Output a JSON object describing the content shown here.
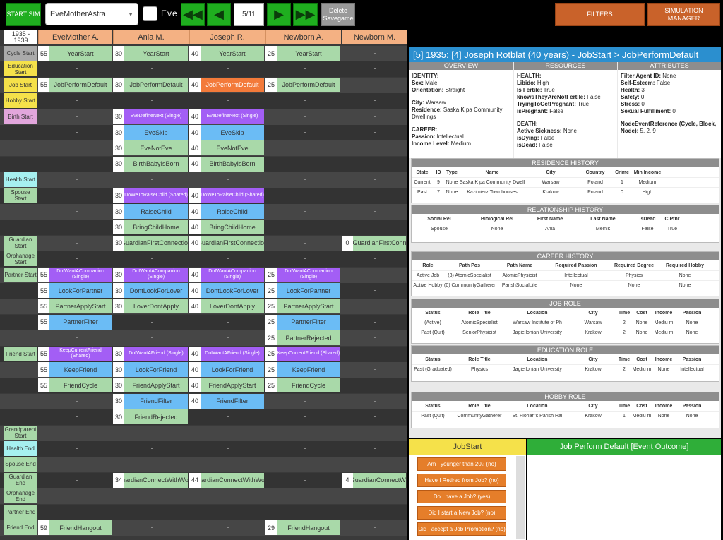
{
  "toolbar": {
    "start_label": "START SIM",
    "agent_dropdown": "EveMotherAstra",
    "checkbox_label": "Eve",
    "page": "5/11",
    "delete_label": "Delete Savegame",
    "filters_label": "FILTERS",
    "simmanager_label": "SIMULATION MANAGER"
  },
  "grid": {
    "year_header": "1935 - 1939",
    "characters": [
      "EveMother A.",
      "Ania M.",
      "Joseph R.",
      "Newborn A.",
      "Newborn M."
    ],
    "row_labels": [
      "Cycle Start",
      "Education Start",
      "Job Start",
      "Hobby Start",
      "Birth Start",
      "",
      "",
      "",
      "Health Start",
      "Spouse Start",
      "",
      "",
      "Guardian Start",
      "Orphanage Start",
      "Partner Start",
      "",
      "",
      "",
      "",
      "Friend Start",
      "",
      "",
      "",
      "",
      "Grandparent Start",
      "Health End",
      "Spouse End",
      "Guardian End",
      "Orphanage End",
      "Partner End",
      "Friend End"
    ],
    "cells": {
      "r0": [
        [
          "55",
          "YearStart"
        ],
        [
          "30",
          "YearStart"
        ],
        [
          "40",
          "YearStart"
        ],
        [
          "25",
          "YearStart"
        ]
      ],
      "r2": [
        [
          "55",
          "JobPerformDefault"
        ],
        [
          "30",
          "JobPerformDefault"
        ],
        [
          "40",
          "JobPerformDefault"
        ],
        [
          "25",
          "JobPerformDefault"
        ]
      ],
      "r4": [
        [
          "30",
          "EveDefineNext (Single)"
        ],
        [
          "40",
          "EveDefineNext (Single)"
        ]
      ],
      "r5": [
        [
          "30",
          "EveSkip"
        ],
        [
          "40",
          "EveSkip"
        ]
      ],
      "r6": [
        [
          "30",
          "EveNotEve"
        ],
        [
          "40",
          "EveNotEve"
        ]
      ],
      "r7": [
        [
          "30",
          "BirthBabyIsBorn"
        ],
        [
          "40",
          "BirthBabyIsBorn"
        ]
      ],
      "r9": [
        [
          "30",
          "DoWeToRaiseChild (Shared)"
        ],
        [
          "40",
          "DoWeToRaiseChild (Shared)"
        ]
      ],
      "r10": [
        [
          "30",
          "RaiseChild"
        ],
        [
          "40",
          "RaiseChild"
        ]
      ],
      "r11": [
        [
          "30",
          "BringChildHome"
        ],
        [
          "40",
          "BringChildHome"
        ]
      ],
      "r12": [
        [
          "30",
          "GuardianFirstConnection"
        ],
        [
          "40",
          "GuardianFirstConnection"
        ],
        [
          "0",
          "GuardianFirstConn"
        ]
      ],
      "r14": [
        [
          "55",
          "DoIWantACompanion (Single)"
        ],
        [
          "30",
          "DoIWantACompanion (Single)"
        ],
        [
          "40",
          "DoIWantACompanion (Single)"
        ],
        [
          "25",
          "DoIWantACompanion (Single)"
        ]
      ],
      "r15": [
        [
          "55",
          "LookForPartner"
        ],
        [
          "30",
          "DontLookForLover"
        ],
        [
          "40",
          "DontLookForLover"
        ],
        [
          "25",
          "LookForPartner"
        ]
      ],
      "r16": [
        [
          "55",
          "PartnerApplyStart"
        ],
        [
          "30",
          "LoverDontApply"
        ],
        [
          "40",
          "LoverDontApply"
        ],
        [
          "25",
          "PartnerApplyStart"
        ]
      ],
      "r17": [
        [
          "55",
          "PartnerFilter"
        ],
        [
          "25",
          "PartnerFilter"
        ]
      ],
      "r18": [
        [
          "25",
          "PartnerRejected"
        ]
      ],
      "r19": [
        [
          "55",
          "KeepCurrentFriend (Shared)"
        ],
        [
          "30",
          "DoIWantAFriend (Single)"
        ],
        [
          "40",
          "DoIWantAFriend (Single)"
        ],
        [
          "25",
          "KeepCurrentFriend (Shared)"
        ]
      ],
      "r20": [
        [
          "55",
          "KeepFriend"
        ],
        [
          "30",
          "LookForFriend"
        ],
        [
          "40",
          "LookForFriend"
        ],
        [
          "25",
          "KeepFriend"
        ]
      ],
      "r21": [
        [
          "55",
          "FriendCycle"
        ],
        [
          "30",
          "FriendApplyStart"
        ],
        [
          "40",
          "FriendApplyStart"
        ],
        [
          "25",
          "FriendCycle"
        ]
      ],
      "r22": [
        [
          "30",
          "FriendFilter"
        ],
        [
          "40",
          "FriendFilter"
        ]
      ],
      "r23": [
        [
          "30",
          "FriendRejected"
        ]
      ],
      "r27": [
        [
          "34",
          "GuardianConnectWithWorld"
        ],
        [
          "44",
          "GuardianConnectWithWorld"
        ],
        [
          "4",
          "GuardianConnectWit"
        ]
      ],
      "r30": [
        [
          "59",
          "FriendHangout"
        ],
        [
          "29",
          "FriendHangout"
        ]
      ]
    }
  },
  "panel": {
    "title": "[5] 1935: [4] Joseph Rotblat (40 years) -  JobStart > JobPerformDefault",
    "overview_hdr": "OVERVIEW",
    "resources_hdr": "RESOURCES",
    "attributes_hdr": "ATTRIBUTES",
    "overview": {
      "identity": "IDENTITY:",
      "sex": "Sex:",
      "sex_v": " Male",
      "orient": "Orientation:",
      "orient_v": " Straight",
      "city": "City:",
      "city_v": " Warsaw",
      "res": "Residence:",
      "res_v": " Saska K pa Community Dwellings",
      "career": "CAREER:",
      "passion": "Passion:",
      "passion_v": " Intellectual",
      "income": "Income Level:",
      "income_v": " Medium"
    },
    "resources": {
      "health": "HEALTH:",
      "libido": "Libido:",
      "libido_v": " High",
      "fertile": "Is Fertile:",
      "fertile_v": " True",
      "knows": "knowsTheyAreNotFertile:",
      "knows_v": " False",
      "trying": "TryingToGetPregnant:",
      "trying_v": " True",
      "preg": "isPregnant:",
      "preg_v": " False",
      "death": "DEATH:",
      "sick": "Active Sickness:",
      "sick_v": " None",
      "dying": "isDying:",
      "dying_v": " False",
      "dead": "isDead:",
      "dead_v": " False"
    },
    "attributes": {
      "fid": "Filter Agent ID:",
      "fid_v": " None",
      "self": "Self-Esteem:",
      "self_v": " False",
      "health": "Health:",
      "health_v": " 3",
      "safety": "Safety:",
      "safety_v": " 0",
      "stress": "Stress:",
      "stress_v": " 0",
      "sex": "Sexual Fulfillment:",
      "sex_v": " 0",
      "node": "NodeEventReference (Cycle, Block, Node):",
      "node_v": " 5, 2, 9"
    },
    "residence": {
      "title": "RESIDENCE HISTORY",
      "headers": [
        "State",
        "ID",
        "Type",
        "Name",
        "City",
        "Country",
        "Crime",
        "Min Income"
      ],
      "rows": [
        [
          "Current",
          "9",
          "None",
          "Saska K pa Community Dwellings",
          "Warsaw",
          "Poland",
          "1",
          "Medium"
        ],
        [
          "Past",
          "7",
          "None",
          "Kazimierz Townhouses",
          "Krakow",
          "Poland",
          "0",
          "High"
        ]
      ]
    },
    "relationship": {
      "title": "RELATIONSHIP HISTORY",
      "headers": [
        "Social Rel",
        "Biological Rel",
        "First Name",
        "Last Name",
        "isDead",
        "C Ptnr"
      ],
      "rows": [
        [
          "Spouse",
          "None",
          "Ania",
          "Melnik",
          "False",
          "True"
        ]
      ]
    },
    "career": {
      "title": "CAREER HISTORY",
      "headers": [
        "Role",
        "Path Pos",
        "Path Name",
        "Required Passion",
        "Required Degree",
        "Required Hobby"
      ],
      "rows": [
        [
          "Active Job",
          "(3) AtomicSpecialist",
          "AtomicPhysicist",
          "Intellectual",
          "Physics",
          "None"
        ],
        [
          "Active Hobby",
          "(0) CommunityGatherer",
          "ParishSocialLife",
          "None",
          "None",
          "None"
        ]
      ]
    },
    "job": {
      "title": "JOB ROLE",
      "headers": [
        "Status",
        "Role Title",
        "Location",
        "City",
        "Time",
        "Cost",
        "Income",
        "Passion"
      ],
      "rows": [
        [
          "(Active)",
          "AtomicSpecialist",
          "Warsaw Institute of Ph",
          "Warsaw",
          "2",
          "None",
          "Mediu m",
          "None"
        ],
        [
          "Past (Quit)",
          "SeniorPhysicist",
          "Jagiellonian University",
          "Krakow",
          "2",
          "None",
          "Mediu m",
          "None"
        ]
      ]
    },
    "education": {
      "title": "EDUCATION ROLE",
      "headers": [
        "Status",
        "Role Title",
        "Location",
        "City",
        "Time",
        "Cost",
        "Income",
        "Passion"
      ],
      "rows": [
        [
          "Past (Graduated)",
          "Physics",
          "Jagiellonian University",
          "Krakow",
          "2",
          "Mediu m",
          "None",
          "Intellectual"
        ]
      ]
    },
    "hobby": {
      "title": "HOBBY ROLE",
      "headers": [
        "Status",
        "Role Title",
        "Location",
        "City",
        "Time",
        "Cost",
        "Income",
        "Passion"
      ],
      "rows": [
        [
          "Past (Quit)",
          "CommunityGatherer",
          "St. Florian's Parish Hal",
          "Krakow",
          "1",
          "Mediu m",
          "None",
          "None"
        ]
      ]
    }
  },
  "jobstart": {
    "title": "JobStart",
    "questions": [
      "Am I younger than 20? (no)",
      "Have I Retired from Job? (no)",
      "Do I have a Job? (yes)",
      "Did I start a New Job? (no)",
      "Did I accept a Job Promotion? (no)"
    ]
  },
  "jobperform": {
    "title": "Job Perform Default [Event Outcome]"
  }
}
